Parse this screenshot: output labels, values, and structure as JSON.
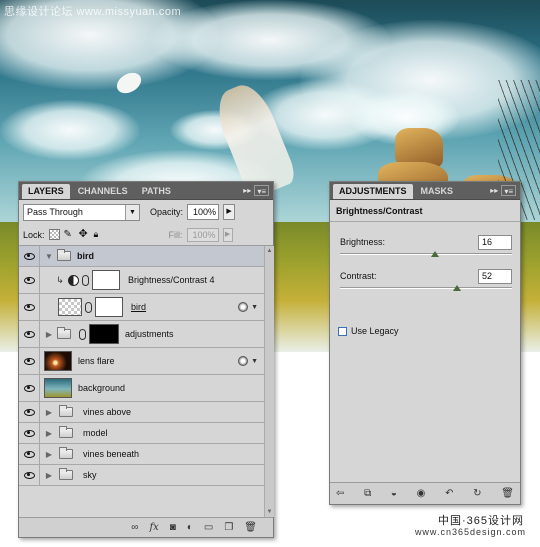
{
  "watermark": "思缘设计论坛 www.missyuan.com",
  "footer": {
    "site_cn": "中国·365设计网",
    "site_url": "www.cn365design.com"
  },
  "layers_panel": {
    "tabs": [
      "LAYERS",
      "CHANNELS",
      "PATHS"
    ],
    "active_tab": "LAYERS",
    "tabbar_controls": [
      "double-chevron-icon",
      "panel-menu-icon"
    ],
    "blend_mode": "Pass Through",
    "opacity_label": "Opacity:",
    "opacity_value": "100%",
    "lock_label": "Lock:",
    "fill_label": "Fill:",
    "fill_value": "100%",
    "layers": [
      {
        "name": "bird",
        "kind": "group",
        "expanded": true,
        "selected": true
      },
      {
        "name": "Brightness/Contrast 4",
        "kind": "adjustment",
        "clipped": true,
        "thumb": "white"
      },
      {
        "name": "bird",
        "kind": "layer",
        "thumb": "checker",
        "mask": "white",
        "has_fx": true
      },
      {
        "name": "adjustments",
        "kind": "group",
        "expanded": false,
        "mask": "black"
      },
      {
        "name": "lens flare",
        "kind": "layer",
        "thumb": "flare",
        "has_fx": true
      },
      {
        "name": "background",
        "kind": "layer",
        "thumb": "bg"
      },
      {
        "name": "vines above",
        "kind": "group",
        "expanded": false
      },
      {
        "name": "model",
        "kind": "group",
        "expanded": false
      },
      {
        "name": "vines beneath",
        "kind": "group",
        "expanded": false
      },
      {
        "name": "sky",
        "kind": "group",
        "expanded": false
      }
    ],
    "footer_icons": [
      "link-icon",
      "fx-icon",
      "mask-icon",
      "adjustment-layer-icon",
      "new-group-icon",
      "new-layer-icon",
      "trash-icon"
    ]
  },
  "adjustments_panel": {
    "tabs": [
      "ADJUSTMENTS",
      "MASKS"
    ],
    "active_tab": "ADJUSTMENTS",
    "title": "Brightness/Contrast",
    "brightness": {
      "label": "Brightness:",
      "value": "16",
      "min": -150,
      "max": 150,
      "num": 16
    },
    "contrast": {
      "label": "Contrast:",
      "value": "52",
      "min": -50,
      "max": 100,
      "num": 52
    },
    "use_legacy": {
      "label": "Use Legacy",
      "checked": false
    },
    "footer_icons": [
      "back-arrow-icon",
      "clip-layer-icon",
      "view-previous-icon",
      "visibility-eye-icon",
      "reset-icon",
      "refresh-icon",
      "trash-icon"
    ]
  },
  "colors": {
    "panel_bg": "#d6d6d6",
    "tabbar_bg": "#5f5f5f",
    "selected_row": "#c3c7d0",
    "slider_thumb": "#4a6a3a"
  }
}
